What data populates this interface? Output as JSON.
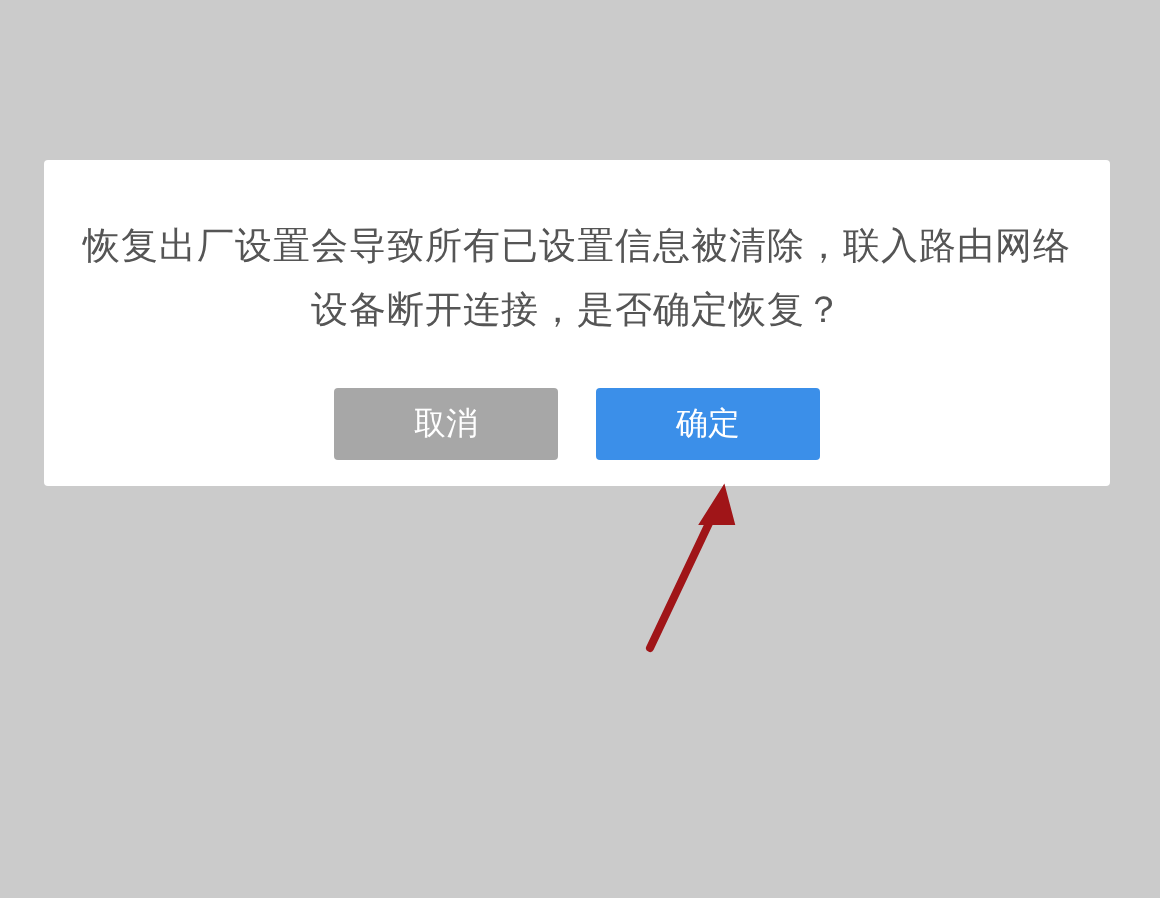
{
  "dialog": {
    "message": "恢复出厂设置会导致所有已设置信息被清除，联入路由网络设备断开连接，是否确定恢复？",
    "buttons": [
      {
        "label": "取消",
        "kind": "cancel"
      },
      {
        "label": "确定",
        "kind": "confirm"
      }
    ]
  }
}
